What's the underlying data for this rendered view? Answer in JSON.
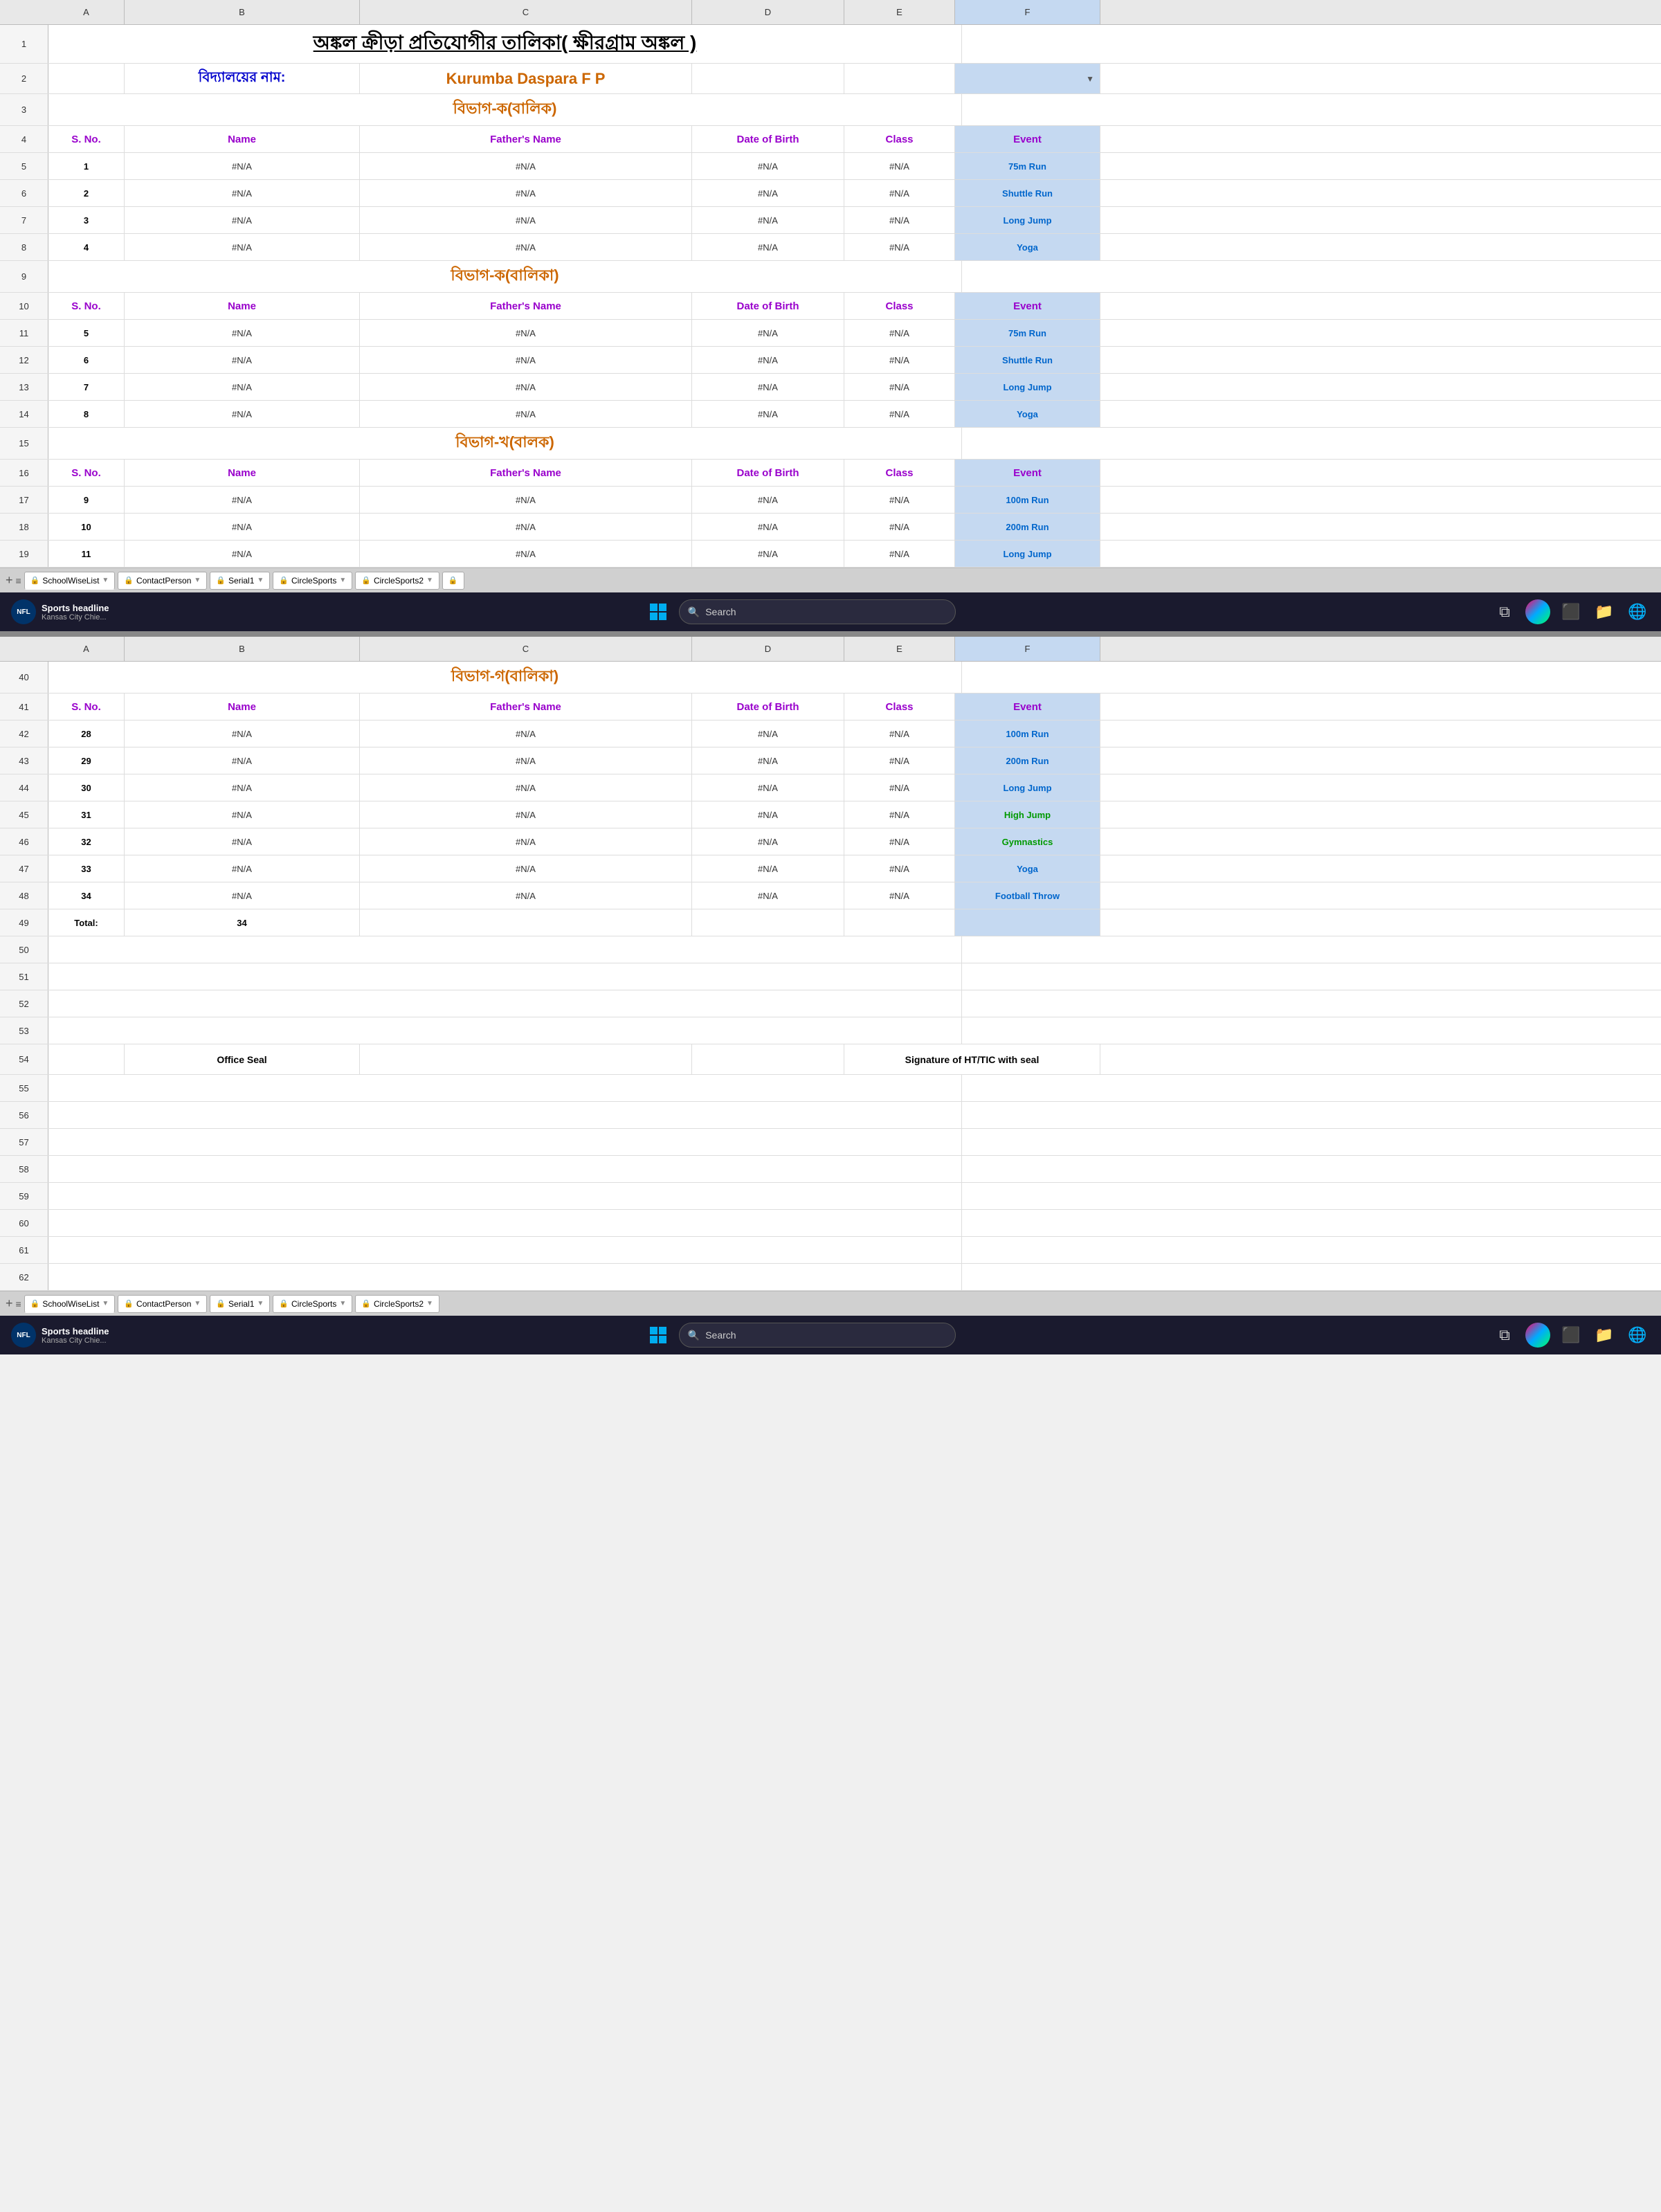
{
  "title": "অঙ্কল ক্রীড়া প্রতিযোগীর তালিকা( ক্ষীরগ্রাম অঙ্কল )",
  "schoolLabel": "বিদ্যালয়ের নাম:",
  "schoolName": "Kurumba Daspara F P",
  "sections": [
    {
      "id": "section1",
      "label": "বিভাগ-ক(বালিক)",
      "startRow": 4,
      "color": "orange",
      "cols": [
        "S. No.",
        "Name",
        "Father's Name",
        "Date of Birth",
        "Class",
        "Event"
      ],
      "rows": [
        {
          "sno": "1",
          "name": "#N/A",
          "father": "#N/A",
          "dob": "#N/A",
          "cls": "#N/A",
          "event": "75m Run",
          "eventClass": "event-75m"
        },
        {
          "sno": "2",
          "name": "#N/A",
          "father": "#N/A",
          "dob": "#N/A",
          "cls": "#N/A",
          "event": "Shuttle Run",
          "eventClass": "event-shuttle"
        },
        {
          "sno": "3",
          "name": "#N/A",
          "father": "#N/A",
          "dob": "#N/A",
          "cls": "#N/A",
          "event": "Long Jump",
          "eventClass": "event-long"
        },
        {
          "sno": "4",
          "name": "#N/A",
          "father": "#N/A",
          "dob": "#N/A",
          "cls": "#N/A",
          "event": "Yoga",
          "eventClass": "event-yoga"
        }
      ]
    },
    {
      "id": "section2",
      "label": "বিভাগ-ক(বালিকা)",
      "color": "orange",
      "cols": [
        "S. No.",
        "Name",
        "Father's Name",
        "Date of Birth",
        "Class",
        "Event"
      ],
      "rows": [
        {
          "sno": "5",
          "name": "#N/A",
          "father": "#N/A",
          "dob": "#N/A",
          "cls": "#N/A",
          "event": "75m Run",
          "eventClass": "event-75m"
        },
        {
          "sno": "6",
          "name": "#N/A",
          "father": "#N/A",
          "dob": "#N/A",
          "cls": "#N/A",
          "event": "Shuttle Run",
          "eventClass": "event-shuttle"
        },
        {
          "sno": "7",
          "name": "#N/A",
          "father": "#N/A",
          "dob": "#N/A",
          "cls": "#N/A",
          "event": "Long Jump",
          "eventClass": "event-long"
        },
        {
          "sno": "8",
          "name": "#N/A",
          "father": "#N/A",
          "dob": "#N/A",
          "cls": "#N/A",
          "event": "Yoga",
          "eventClass": "event-yoga"
        }
      ]
    },
    {
      "id": "section3",
      "label": "বিভাগ-খ(বালক)",
      "color": "orange",
      "cols": [
        "S. No.",
        "Name",
        "Father's Name",
        "Date of Birth",
        "Class",
        "Event"
      ],
      "rows": [
        {
          "sno": "9",
          "name": "#N/A",
          "father": "#N/A",
          "dob": "#N/A",
          "cls": "#N/A",
          "event": "100m Run",
          "eventClass": "event-100m"
        },
        {
          "sno": "10",
          "name": "#N/A",
          "father": "#N/A",
          "dob": "#N/A",
          "cls": "#N/A",
          "event": "200m Run",
          "eventClass": "event-200m"
        },
        {
          "sno": "11",
          "name": "#N/A",
          "father": "#N/A",
          "dob": "#N/A",
          "cls": "#N/A",
          "event": "Long Jump",
          "eventClass": "event-long"
        }
      ]
    }
  ],
  "section_g": {
    "label": "বিভাগ-গ(বালিকা)",
    "rowStart": 40,
    "cols": [
      "S. No.",
      "Name",
      "Father's Name",
      "Date of Birth",
      "Class",
      "Event"
    ],
    "rows": [
      {
        "rowNum": "42",
        "sno": "28",
        "name": "#N/A",
        "father": "#N/A",
        "dob": "#N/A",
        "cls": "#N/A",
        "event": "100m Run",
        "eventClass": "event-100m"
      },
      {
        "rowNum": "43",
        "sno": "29",
        "name": "#N/A",
        "father": "#N/A",
        "dob": "#N/A",
        "cls": "#N/A",
        "event": "200m Run",
        "eventClass": "event-200m"
      },
      {
        "rowNum": "44",
        "sno": "30",
        "name": "#N/A",
        "father": "#N/A",
        "dob": "#N/A",
        "cls": "#N/A",
        "event": "Long Jump",
        "eventClass": "event-long"
      },
      {
        "rowNum": "45",
        "sno": "31",
        "name": "#N/A",
        "father": "#N/A",
        "dob": "#N/A",
        "cls": "#N/A",
        "event": "High Jump",
        "eventClass": "event-high"
      },
      {
        "rowNum": "46",
        "sno": "32",
        "name": "#N/A",
        "father": "#N/A",
        "dob": "#N/A",
        "cls": "#N/A",
        "event": "Gymnastics",
        "eventClass": "event-gym"
      },
      {
        "rowNum": "47",
        "sno": "33",
        "name": "#N/A",
        "father": "#N/A",
        "dob": "#N/A",
        "cls": "#N/A",
        "event": "Yoga",
        "eventClass": "event-yoga"
      },
      {
        "rowNum": "48",
        "sno": "34",
        "name": "#N/A",
        "father": "#N/A",
        "dob": "#N/A",
        "cls": "#N/A",
        "event": "Football Throw",
        "eventClass": "event-football"
      }
    ]
  },
  "total": {
    "label": "Total:",
    "value": "34",
    "rowNum": "49"
  },
  "officeSeal": "Office Seal",
  "signature": "Signature of HT/TIC with seal",
  "tabs": {
    "plus": "+",
    "menu": "≡",
    "active": "SchoolWiseList",
    "items": [
      "SchoolWiseList",
      "ContactPerson",
      "Serial1",
      "CircleSports",
      "CircleSports2"
    ]
  },
  "taskbar": {
    "searchPlaceholder": "Search",
    "sportsHeadline": "Sports headline",
    "sportsSubtitle": "Kansas City Chie..."
  },
  "columns": {
    "A": "A",
    "B": "B",
    "C": "C",
    "D": "D",
    "E": "E",
    "F": "F"
  }
}
